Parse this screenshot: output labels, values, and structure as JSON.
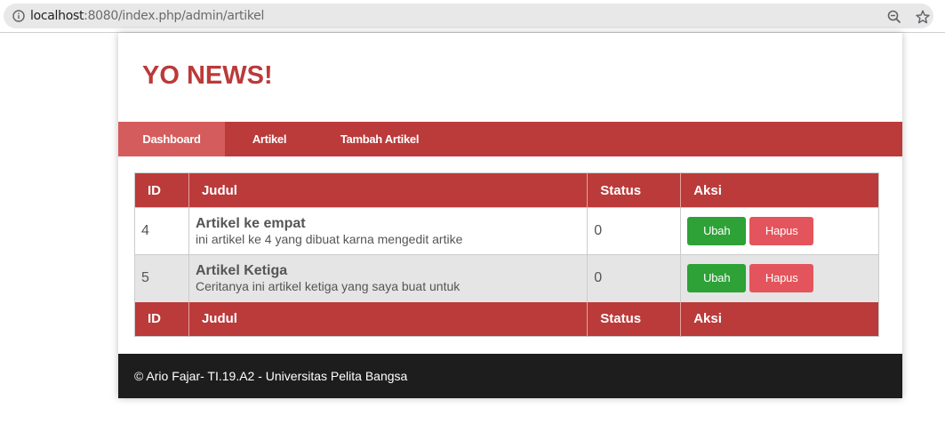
{
  "browser": {
    "url_host": "localhost",
    "url_path": ":8080/index.php/admin/artikel",
    "icons": [
      "info-icon",
      "zoom-out-icon",
      "star-icon"
    ]
  },
  "site": {
    "title": "YO NEWS!"
  },
  "nav": {
    "items": [
      {
        "label": "Dashboard",
        "active": true
      },
      {
        "label": "Artikel",
        "active": false
      },
      {
        "label": "Tambah Artikel",
        "active": false
      }
    ]
  },
  "table": {
    "headers": [
      "ID",
      "Judul",
      "Status",
      "Aksi"
    ],
    "rows": [
      {
        "id": "4",
        "title": "Artikel ke empat",
        "desc": "ini artikel ke 4 yang dibuat karna mengedit artike",
        "status": "0",
        "edit_label": "Ubah",
        "delete_label": "Hapus"
      },
      {
        "id": "5",
        "title": "Artikel Ketiga",
        "desc": "Ceritanya ini artikel ketiga yang saya buat untuk",
        "status": "0",
        "edit_label": "Ubah",
        "delete_label": "Hapus"
      }
    ],
    "footer_headers": [
      "ID",
      "Judul",
      "Status",
      "Aksi"
    ]
  },
  "footer": {
    "text": "© Ario Fajar- TI.19.A2 - Universitas Pelita Bangsa"
  },
  "colors": {
    "brand": "#bb3a3a",
    "nav_active": "#d45c5c",
    "edit_button": "#2ea137",
    "delete_button": "#e4545c",
    "footer_bg": "#1d1d1d"
  }
}
